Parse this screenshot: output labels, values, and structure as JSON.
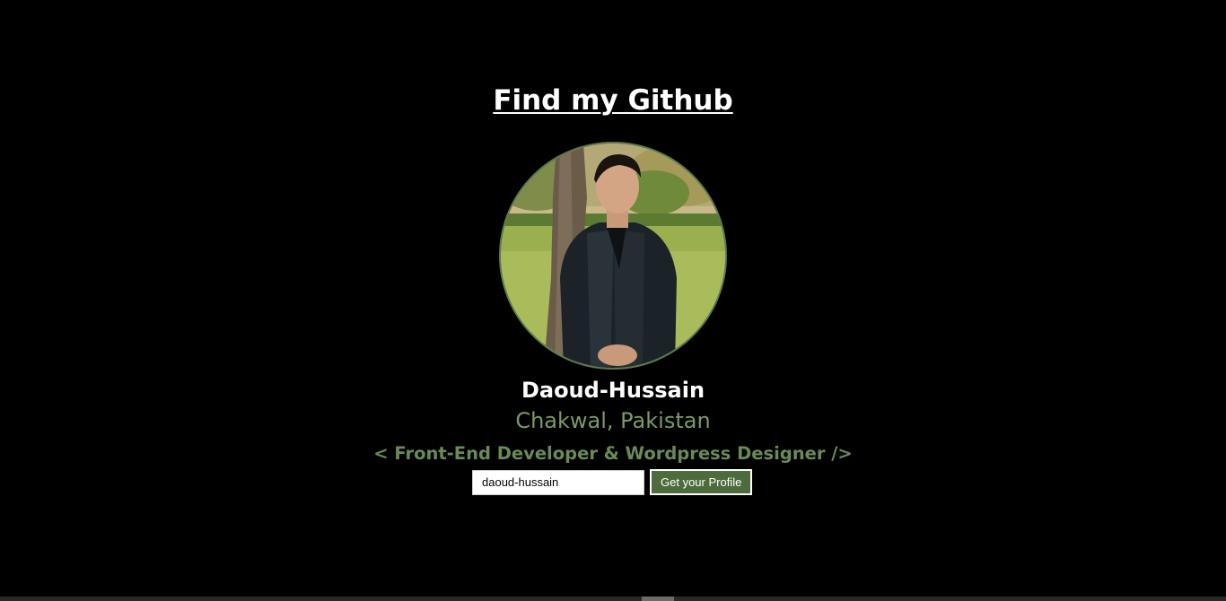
{
  "header": {
    "title": "Find my Github"
  },
  "profile": {
    "avatar_icon": "user-photo",
    "name": "Daoud-Hussain",
    "location": "Chakwal, Pakistan",
    "bio": "< Front-End Developer & Wordpress Designer />"
  },
  "search": {
    "value": "daoud-hussain",
    "placeholder": "",
    "button_label": "Get your Profile"
  },
  "colors": {
    "background": "#000000",
    "accent": "#4d6b3d",
    "location_text": "#7d9a66",
    "bio_text": "#6a8a56",
    "avatar_border": "#5b7a4a"
  }
}
